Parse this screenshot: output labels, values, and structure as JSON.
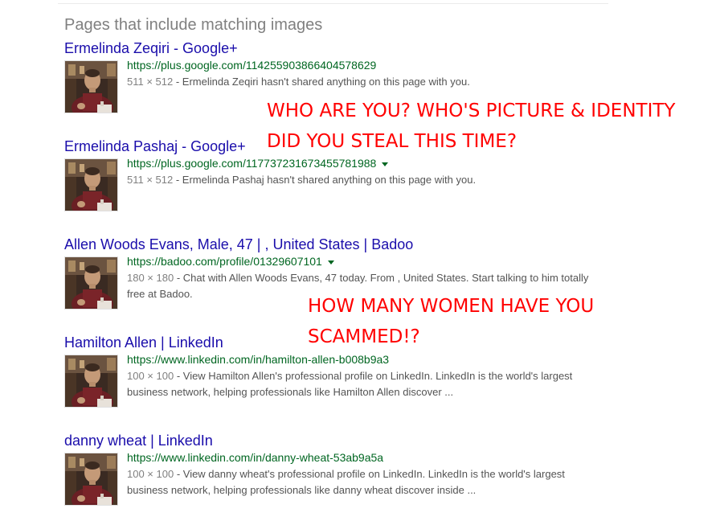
{
  "section_heading": "Pages that include matching images",
  "results": [
    {
      "title": "Ermelinda Zeqiri - Google+",
      "url": "https://plus.google.com/114255903866404578629",
      "has_caret": false,
      "dims": "511 × 512",
      "snippet": " - Ermelinda Zeqiri hasn't shared anything on this page with you."
    },
    {
      "title": "Ermelinda Pashaj - Google+",
      "url": "https://plus.google.com/117737231673455781988",
      "has_caret": true,
      "dims": "511 × 512",
      "snippet": " - Ermelinda Pashaj hasn't shared anything on this page with you."
    },
    {
      "title": "Allen Woods Evans, Male, 47 | , United States | Badoo",
      "url": "https://badoo.com/profile/01329607101",
      "has_caret": true,
      "dims": "180 × 180",
      "snippet": " - Chat with Allen Woods Evans, 47 today. From , United States. Start talking to him totally free at Badoo."
    },
    {
      "title": "Hamilton Allen | LinkedIn",
      "url": "https://www.linkedin.com/in/hamilton-allen-b008b9a3",
      "has_caret": false,
      "dims": "100 × 100",
      "snippet": " - View Hamilton Allen's professional profile on LinkedIn. LinkedIn is the world's largest business network, helping professionals like Hamilton Allen discover ..."
    },
    {
      "title": "danny wheat | LinkedIn",
      "url": "https://www.linkedin.com/in/danny-wheat-53ab9a5a",
      "has_caret": false,
      "dims": "100 × 100",
      "snippet": " - View danny wheat's professional profile on LinkedIn. LinkedIn is the world's largest business network, helping professionals like danny wheat discover inside ..."
    }
  ],
  "annotations": {
    "first": {
      "line1": "WHO ARE YOU? WHO'S PICTURE & IDENTITY",
      "line2": "DID YOU STEAL THIS TIME?"
    },
    "second": {
      "line1": "HOW MANY WOMEN HAVE YOU",
      "line2": "SCAMMED!?"
    }
  },
  "colors": {
    "title_link": "#1a0dab",
    "url_green": "#006621",
    "snippet_gray": "#545454",
    "annotation_red": "#ff0000"
  }
}
